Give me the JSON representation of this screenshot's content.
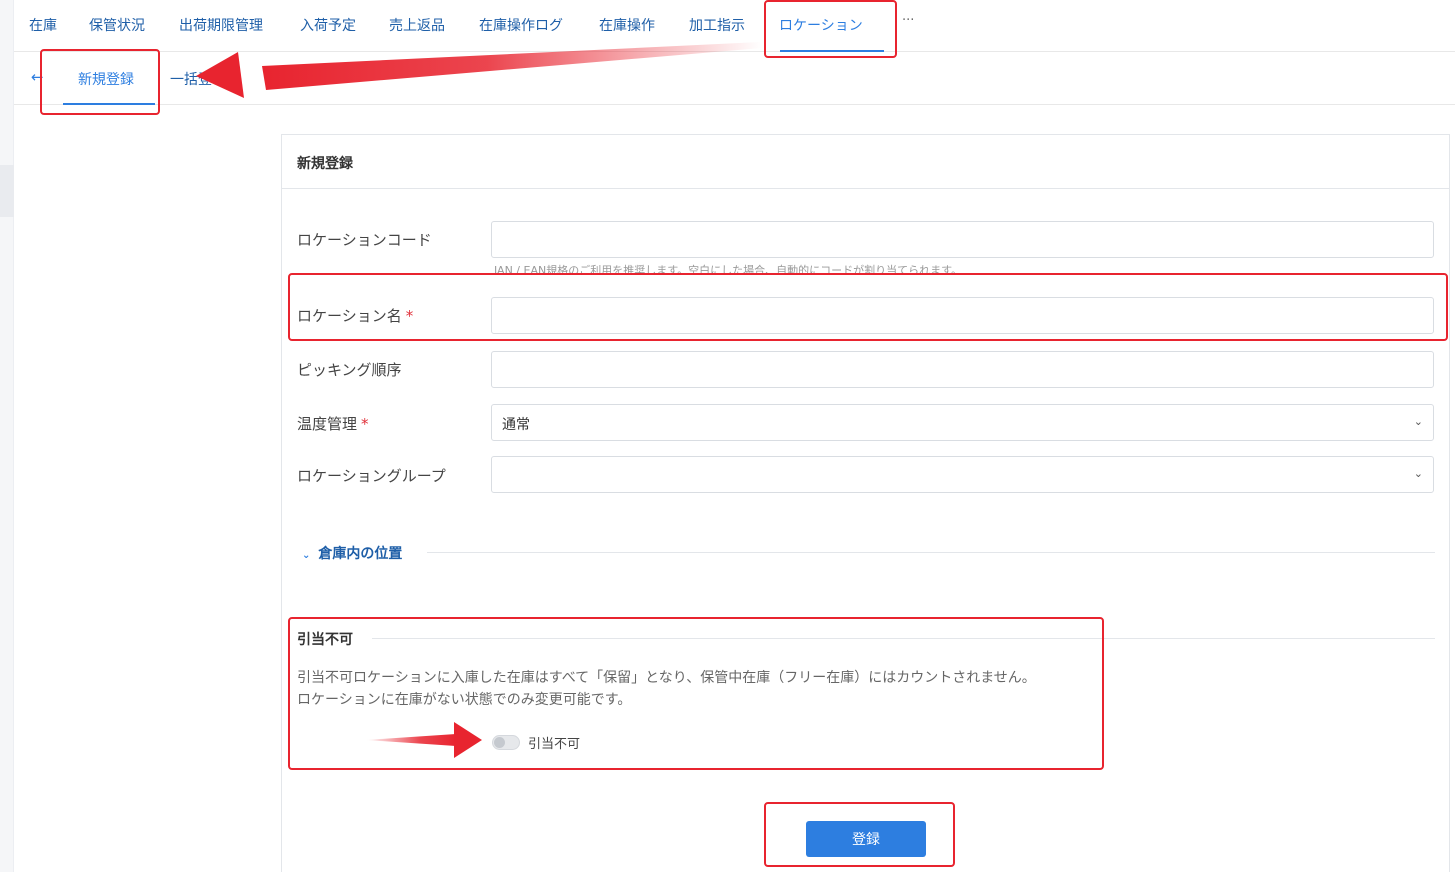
{
  "top_nav": {
    "items": [
      {
        "label": "在庫"
      },
      {
        "label": "保管状況"
      },
      {
        "label": "出荷期限管理"
      },
      {
        "label": "入荷予定"
      },
      {
        "label": "売上返品"
      },
      {
        "label": "在庫操作ログ"
      },
      {
        "label": "在庫操作"
      },
      {
        "label": "加工指示"
      },
      {
        "label": "ロケーション"
      }
    ],
    "active": "ロケーション",
    "more_label": "···"
  },
  "sub_nav": {
    "back_icon": "arrow-left-icon",
    "tabs": [
      {
        "label": "新規登録"
      },
      {
        "label": "一括登"
      }
    ],
    "active": "新規登録"
  },
  "form": {
    "title": "新規登録",
    "fields": {
      "location_code": {
        "label": "ロケーションコード",
        "value": "",
        "hint": "JAN / EAN規格のご利用を推奨します。空白にした場合、自動的にコードが割り当てられます。"
      },
      "location_name": {
        "label": "ロケーション名",
        "required_mark": "*",
        "value": ""
      },
      "picking_order": {
        "label": "ピッキング順序",
        "value": ""
      },
      "temperature": {
        "label": "温度管理",
        "required_mark": "*",
        "value": "通常"
      },
      "location_group": {
        "label": "ロケーショングループ",
        "value": ""
      }
    },
    "warehouse_section": {
      "label": "倉庫内の位置",
      "icon": "chevron-down-icon"
    },
    "unallocatable": {
      "title": "引当不可",
      "desc_line1": "引当不可ロケーションに入庫した在庫はすべて「保留」となり、保管中在庫（フリー在庫）にはカウントされません。",
      "desc_line2": "ロケーションに在庫がない状態でのみ変更可能です。",
      "toggle_label": "引当不可",
      "toggle_on": false
    },
    "submit_label": "登録"
  },
  "colors": {
    "accent": "#2d7ee0",
    "annotation": "#e8242f"
  }
}
